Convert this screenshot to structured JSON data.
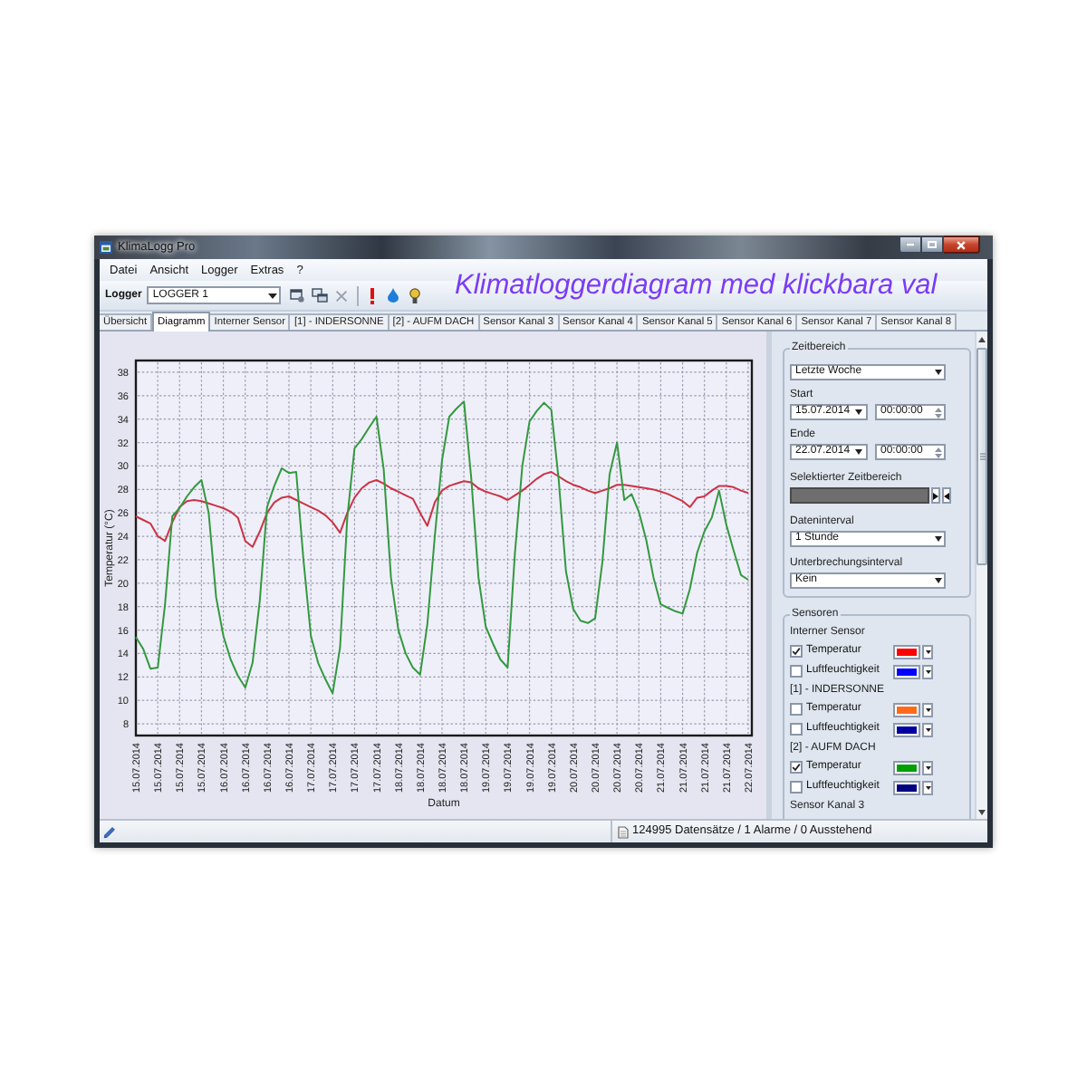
{
  "window": {
    "title": "KlimaLogg Pro"
  },
  "menu": [
    "Datei",
    "Ansicht",
    "Logger",
    "Extras",
    "?"
  ],
  "toolbar": {
    "label": "Logger",
    "logger_select": {
      "value": "LOGGER 1"
    }
  },
  "caption": "Klimatloggerdiagram med klickbara val",
  "tabs": [
    {
      "label": "Übersicht",
      "selected": false
    },
    {
      "label": "Diagramm",
      "selected": true
    },
    {
      "label": "Interner Sensor",
      "selected": false
    },
    {
      "label": "[1] - INDERSONNE",
      "selected": false
    },
    {
      "label": "[2] - AUFM DACH",
      "selected": false
    },
    {
      "label": "Sensor Kanal 3",
      "selected": false
    },
    {
      "label": "Sensor Kanal 4",
      "selected": false
    },
    {
      "label": "Sensor Kanal 5",
      "selected": false
    },
    {
      "label": "Sensor Kanal 6",
      "selected": false
    },
    {
      "label": "Sensor Kanal 7",
      "selected": false
    },
    {
      "label": "Sensor Kanal 8",
      "selected": false
    }
  ],
  "chart": {
    "chart_data": {
      "type": "line",
      "xlabel": "Datum",
      "ylabel": "Temperatur (°C)",
      "grid": true,
      "categories": [
        "15.07.2014",
        null,
        null,
        "15.07.2014",
        null,
        null,
        "15.07.2014",
        null,
        null,
        "15.07.2014",
        null,
        null,
        "16.07.2014",
        null,
        null,
        "16.07.2014",
        null,
        null,
        "16.07.2014",
        null,
        null,
        "16.07.2014",
        null,
        null,
        "17.07.2014",
        null,
        null,
        "17.07.2014",
        null,
        null,
        "17.07.2014",
        null,
        null,
        "17.07.2014",
        null,
        null,
        "18.07.2014",
        null,
        null,
        "18.07.2014",
        null,
        null,
        "18.07.2014",
        null,
        null,
        "18.07.2014",
        null,
        null,
        "19.07.2014",
        null,
        null,
        "19.07.2014",
        null,
        null,
        "19.07.2014",
        null,
        null,
        "19.07.2014",
        null,
        null,
        "20.07.2014",
        null,
        null,
        "20.07.2014",
        null,
        null,
        "20.07.2014",
        null,
        null,
        "20.07.2014",
        null,
        null,
        "21.07.2014",
        null,
        null,
        "21.07.2014",
        null,
        null,
        "21.07.2014",
        null,
        null,
        "21.07.2014",
        null,
        null,
        "22.07.2014"
      ],
      "series": [
        {
          "color": "#cc3344",
          "values": [
            25.7,
            25.4,
            25.1,
            24.0,
            23.6,
            25.2,
            26.5,
            27.0,
            27.1,
            27.0,
            26.8,
            26.6,
            26.4,
            26.1,
            25.6,
            23.6,
            23.1,
            24.4,
            26.0,
            26.9,
            27.3,
            27.4,
            27.1,
            26.8,
            26.5,
            26.2,
            25.8,
            25.2,
            24.3,
            26.0,
            27.3,
            28.1,
            28.6,
            28.8,
            28.5,
            28.1,
            27.8,
            27.5,
            27.2,
            26.0,
            24.9,
            26.9,
            27.9,
            28.3,
            28.5,
            28.7,
            28.6,
            28.1,
            27.8,
            27.6,
            27.4,
            27.1,
            27.5,
            27.9,
            28.4,
            28.9,
            29.3,
            29.5,
            29.1,
            28.7,
            28.4,
            28.2,
            27.9,
            27.7,
            27.9,
            28.1,
            28.4,
            28.4,
            28.3,
            28.2,
            28.1,
            28.0,
            27.8,
            27.6,
            27.3,
            27.0,
            26.5,
            27.3,
            27.4,
            27.9,
            28.3,
            28.3,
            28.2,
            27.9,
            27.7
          ]
        },
        {
          "color": "#33993f",
          "values": [
            15.4,
            14.4,
            12.7,
            12.8,
            18.2,
            25.7,
            26.4,
            27.4,
            28.2,
            28.8,
            26,
            18.8,
            15.5,
            13.5,
            12.1,
            11.1,
            13.2,
            18.5,
            26.5,
            28.3,
            29.8,
            29.4,
            29.5,
            22,
            15.5,
            13.2,
            11.8,
            10.6,
            14.5,
            25.6,
            31.5,
            32.3,
            33.3,
            34.2,
            29.7,
            20.5,
            16,
            14.0,
            12.8,
            12.2,
            16.5,
            24.0,
            30.5,
            34.2,
            34.9,
            35.5,
            29,
            20.5,
            16.3,
            14.8,
            13.5,
            12.8,
            22.5,
            30,
            33.8,
            34.7,
            35.4,
            34.8,
            28.8,
            21,
            17.8,
            16.8,
            16.6,
            17.0,
            21.8,
            29.3,
            32.0,
            27.1,
            27.6,
            26.1,
            23.7,
            20.5,
            18.2,
            17.9,
            17.6,
            17.4,
            19.5,
            22.6,
            24.4,
            25.6,
            27.9,
            25.0,
            22.8,
            20.7,
            20.3
          ]
        }
      ],
      "ylim": [
        7,
        39
      ],
      "yticks": [
        8,
        10,
        12,
        14,
        16,
        18,
        20,
        22,
        24,
        26,
        28,
        30,
        32,
        34,
        36,
        38
      ]
    }
  },
  "side_panel": {
    "time_range": {
      "title": "Zeitbereich",
      "preset": "Letzte Woche",
      "start_label": "Start",
      "start_date": "15.07.2014",
      "start_time": "00:00:00",
      "end_label": "Ende",
      "end_date": "22.07.2014",
      "end_time": "00:00:00",
      "selection_label": "Selektierter Zeitbereich",
      "data_interval_label": "Dateninterval",
      "data_interval": "1 Stunde",
      "gap_interval_label": "Unterbrechungsinterval",
      "gap_interval": "Kein"
    },
    "sensors": {
      "title": "Sensoren",
      "groups": [
        {
          "name": "Interner Sensor",
          "channels": [
            {
              "label": "Temperatur",
              "checked": true,
              "color": "#ff0000"
            },
            {
              "label": "Luftfeuchtigkeit",
              "checked": false,
              "color": "#0000ff"
            }
          ]
        },
        {
          "name": "[1] - INDERSONNE",
          "channels": [
            {
              "label": "Temperatur",
              "checked": false,
              "color": "#ff6a1a"
            },
            {
              "label": "Luftfeuchtigkeit",
              "checked": false,
              "color": "#0000a0"
            }
          ]
        },
        {
          "name": "[2] - AUFM DACH",
          "channels": [
            {
              "label": "Temperatur",
              "checked": true,
              "color": "#00a000"
            },
            {
              "label": "Luftfeuchtigkeit",
              "checked": false,
              "color": "#000080"
            }
          ]
        },
        {
          "name": "Sensor Kanal 3"
        }
      ]
    }
  },
  "status_bar": {
    "text": "124995 Datensätze / 1 Alarme / 0 Ausstehend"
  }
}
